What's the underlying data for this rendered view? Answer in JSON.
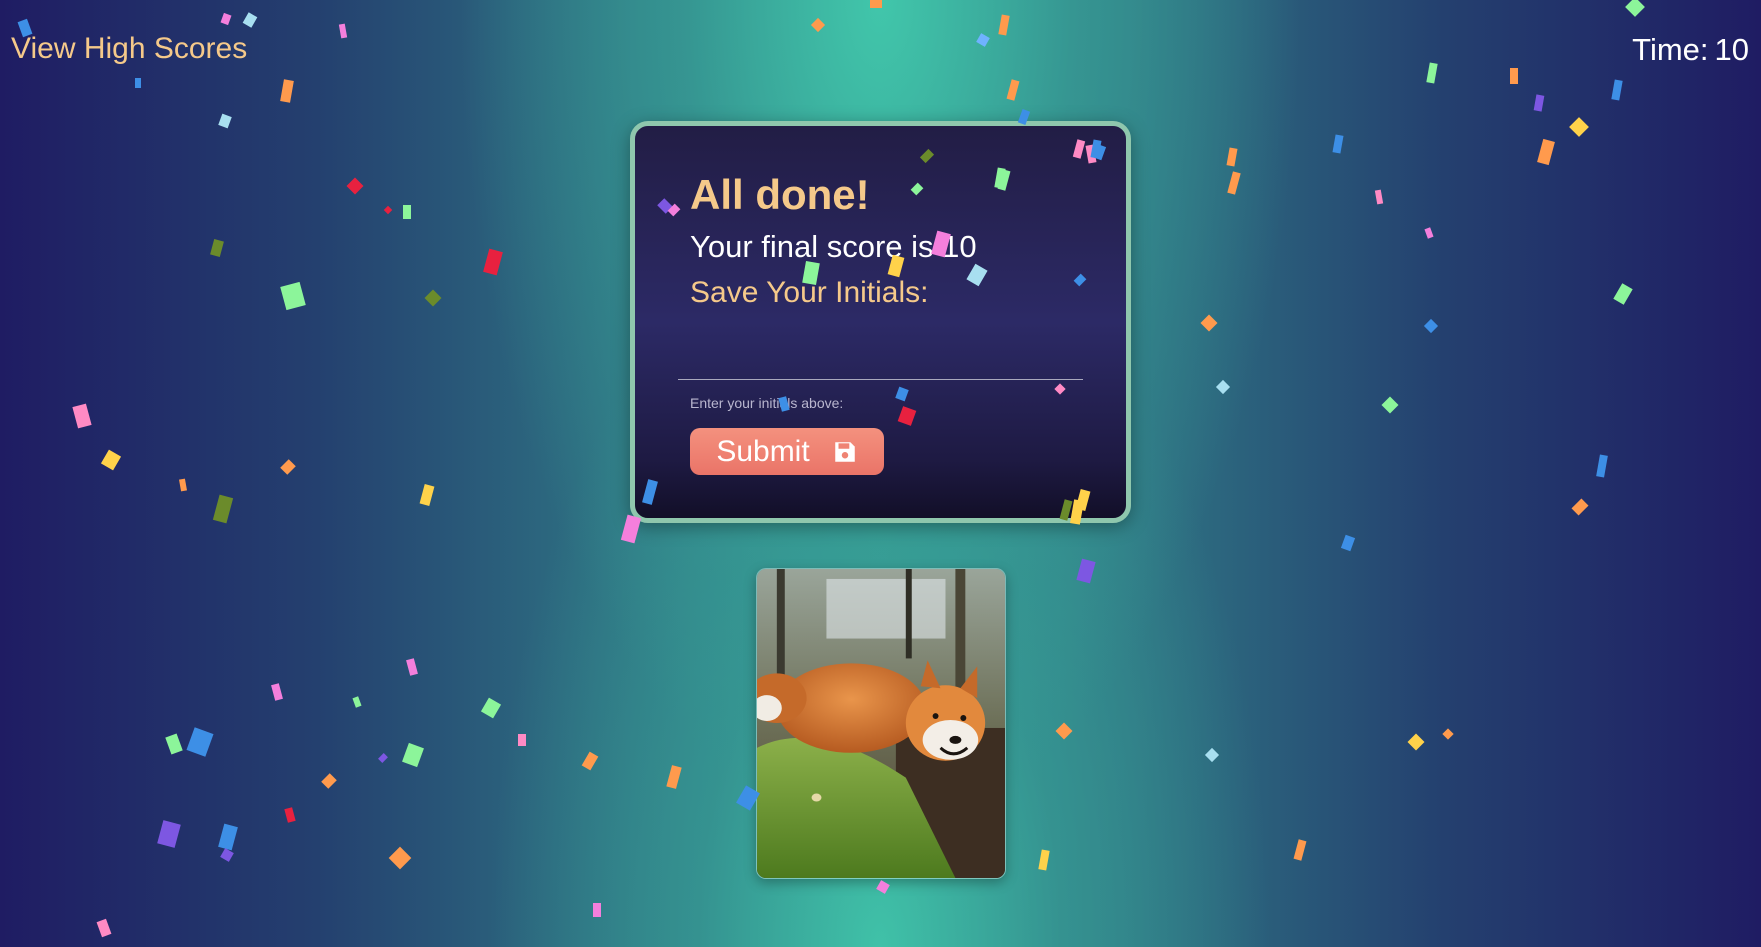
{
  "header": {
    "high_scores_link": "View High Scores",
    "timer_label": "Time:",
    "timer_value": "10"
  },
  "card": {
    "title": "All done!",
    "score_text": "Your final score is 10",
    "save_label": "Save Your Initials:",
    "input_value": "",
    "helper_text": "Enter your initials above:",
    "submit_label": "Submit",
    "submit_icon": "floppy-disk-save-icon"
  },
  "image": {
    "subject": "smiling red fox lying on mossy log"
  },
  "colors": {
    "accent_text": "#f5c98a",
    "card_border": "#8fc7ad",
    "submit_button": "#ef8373",
    "confetti": [
      "#ff8ac4",
      "#f47fdc",
      "#3d8fe6",
      "#7d57e2",
      "#8cf59a",
      "#ff9a4d",
      "#ffd24a",
      "#e8213f",
      "#6fb2ff",
      "#6b8b2b",
      "#a8dff0"
    ]
  }
}
